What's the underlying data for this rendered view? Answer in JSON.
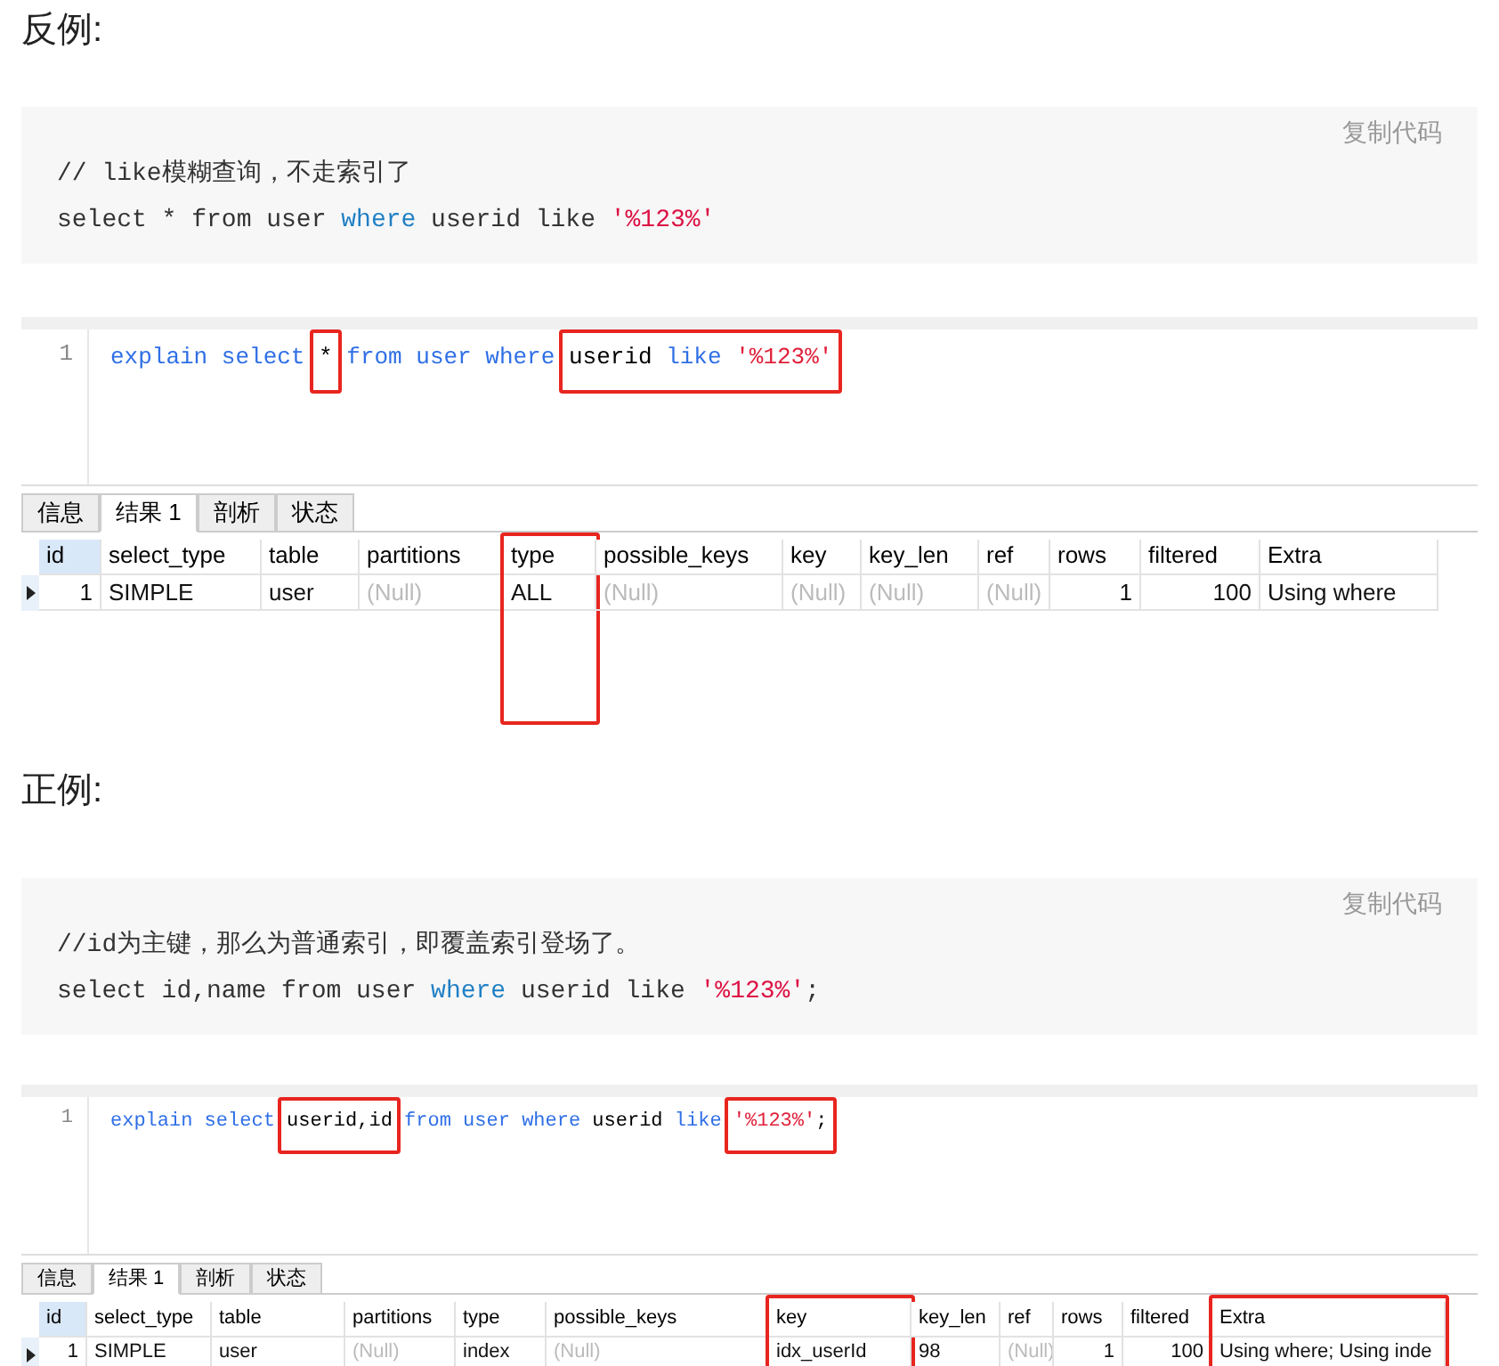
{
  "sections": [
    {
      "heading": "反例:",
      "code_block": {
        "copy_label": "复制代码",
        "lines": [
          [
            {
              "text": "// like模糊查询，不走索引了",
              "kind": "plain"
            }
          ],
          [
            {
              "text": "select * from user ",
              "kind": "plain"
            },
            {
              "text": "where",
              "kind": "keyword"
            },
            {
              "text": " userid like ",
              "kind": "plain"
            },
            {
              "text": "'%123%'",
              "kind": "string"
            }
          ]
        ]
      },
      "editor": {
        "line_number": "1",
        "segments": [
          {
            "highlighted": false,
            "tokens": [
              {
                "text": "explain select ",
                "kind": "keyword"
              }
            ]
          },
          {
            "highlighted": true,
            "tokens": [
              {
                "text": "*",
                "kind": "plain"
              }
            ]
          },
          {
            "highlighted": false,
            "tokens": [
              {
                "text": " from user where ",
                "kind": "keyword"
              }
            ]
          },
          {
            "highlighted": true,
            "tokens": [
              {
                "text": "userid ",
                "kind": "plain"
              },
              {
                "text": "like ",
                "kind": "keyword"
              },
              {
                "text": "'%123%'",
                "kind": "string"
              }
            ]
          }
        ]
      },
      "tabs": [
        {
          "label": "信息",
          "selected": false
        },
        {
          "label": "结果 1",
          "selected": true
        },
        {
          "label": "剖析",
          "selected": false
        },
        {
          "label": "状态",
          "selected": false
        }
      ],
      "table": {
        "columns": [
          {
            "label": "id",
            "highlighted": false
          },
          {
            "label": "select_type",
            "highlighted": false
          },
          {
            "label": "table",
            "highlighted": false
          },
          {
            "label": "partitions",
            "highlighted": false
          },
          {
            "label": "type",
            "highlighted": true
          },
          {
            "label": "possible_keys",
            "highlighted": false
          },
          {
            "label": "key",
            "highlighted": false
          },
          {
            "label": "key_len",
            "highlighted": false
          },
          {
            "label": "ref",
            "highlighted": false
          },
          {
            "label": "rows",
            "highlighted": false
          },
          {
            "label": "filtered",
            "highlighted": false
          },
          {
            "label": "Extra",
            "highlighted": false
          }
        ],
        "rows": [
          {
            "cells": [
              {
                "text": "1",
                "kind": "number"
              },
              {
                "text": "SIMPLE",
                "kind": "text"
              },
              {
                "text": "user",
                "kind": "text"
              },
              {
                "text": "(Null)",
                "kind": "null"
              },
              {
                "text": "ALL",
                "kind": "text"
              },
              {
                "text": "(Null)",
                "kind": "null"
              },
              {
                "text": "(Null)",
                "kind": "null"
              },
              {
                "text": "(Null)",
                "kind": "null"
              },
              {
                "text": "(Null)",
                "kind": "null"
              },
              {
                "text": "1",
                "kind": "number"
              },
              {
                "text": "100",
                "kind": "number"
              },
              {
                "text": "Using where",
                "kind": "text"
              }
            ]
          }
        ]
      }
    },
    {
      "heading": "正例:",
      "code_block": {
        "copy_label": "复制代码",
        "lines": [
          [
            {
              "text": "//id为主键，那么为普通索引，即覆盖索引登场了。",
              "kind": "plain"
            }
          ],
          [
            {
              "text": "select id,name from user ",
              "kind": "plain"
            },
            {
              "text": "where",
              "kind": "keyword"
            },
            {
              "text": " userid like ",
              "kind": "plain"
            },
            {
              "text": "'%123%'",
              "kind": "string"
            },
            {
              "text": ";",
              "kind": "plain"
            }
          ]
        ]
      },
      "editor": {
        "line_number": "1",
        "segments": [
          {
            "highlighted": false,
            "tokens": [
              {
                "text": "explain select ",
                "kind": "keyword"
              }
            ]
          },
          {
            "highlighted": true,
            "tokens": [
              {
                "text": "userid,id",
                "kind": "plain"
              }
            ]
          },
          {
            "highlighted": false,
            "tokens": [
              {
                "text": " from user where ",
                "kind": "keyword"
              },
              {
                "text": "userid ",
                "kind": "plain"
              },
              {
                "text": "like ",
                "kind": "keyword"
              }
            ]
          },
          {
            "highlighted": true,
            "tokens": [
              {
                "text": "'%123%'",
                "kind": "string"
              },
              {
                "text": ";",
                "kind": "plain"
              }
            ]
          }
        ]
      },
      "tabs": [
        {
          "label": "信息",
          "selected": false
        },
        {
          "label": "结果 1",
          "selected": true
        },
        {
          "label": "剖析",
          "selected": false
        },
        {
          "label": "状态",
          "selected": false
        }
      ],
      "table": {
        "columns": [
          {
            "label": "id",
            "highlighted": false
          },
          {
            "label": "select_type",
            "highlighted": false
          },
          {
            "label": "table",
            "highlighted": false
          },
          {
            "label": "partitions",
            "highlighted": false
          },
          {
            "label": "type",
            "highlighted": false
          },
          {
            "label": "possible_keys",
            "highlighted": false
          },
          {
            "label": "key",
            "highlighted": true
          },
          {
            "label": "key_len",
            "highlighted": false
          },
          {
            "label": "ref",
            "highlighted": false
          },
          {
            "label": "rows",
            "highlighted": false
          },
          {
            "label": "filtered",
            "highlighted": false
          },
          {
            "label": "Extra",
            "highlighted": true
          }
        ],
        "rows": [
          {
            "cells": [
              {
                "text": "1",
                "kind": "number"
              },
              {
                "text": "SIMPLE",
                "kind": "text"
              },
              {
                "text": "user",
                "kind": "text"
              },
              {
                "text": "(Null)",
                "kind": "null"
              },
              {
                "text": "index",
                "kind": "text"
              },
              {
                "text": "(Null)",
                "kind": "null"
              },
              {
                "text": "idx_userId",
                "kind": "text"
              },
              {
                "text": "98",
                "kind": "text"
              },
              {
                "text": "(Null)",
                "kind": "null"
              },
              {
                "text": "1",
                "kind": "number"
              },
              {
                "text": "100",
                "kind": "number"
              },
              {
                "text": "Using where; Using inde",
                "kind": "text"
              }
            ]
          }
        ]
      }
    }
  ]
}
